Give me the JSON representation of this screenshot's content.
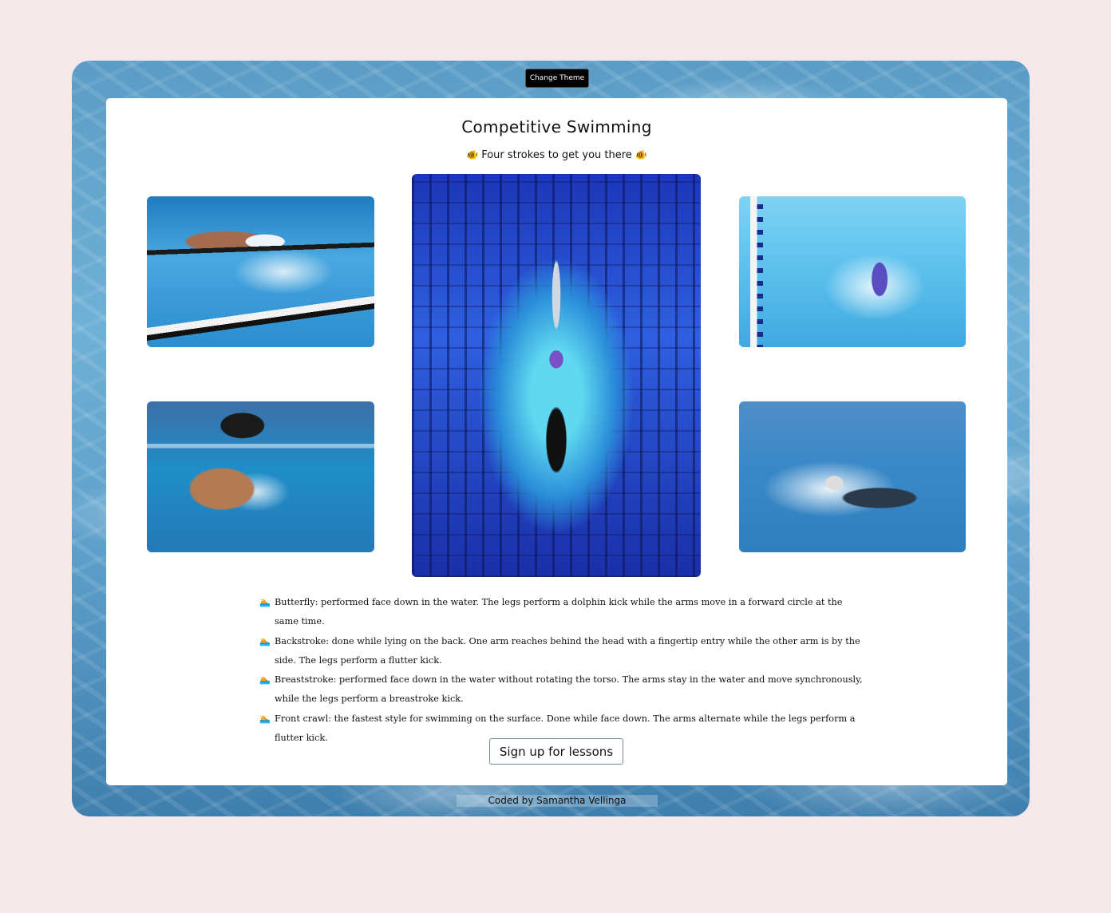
{
  "theme_button": {
    "label": "Change Theme"
  },
  "card": {
    "title": "Competitive Swimming",
    "subtitle": "Four strokes to get you there",
    "fish_icon": "🐠",
    "swimmer_icon": "🏊",
    "strokes": [
      {
        "text": "Butterfly: performed face down in the water. The legs perform a dolphin kick while the arms move in a forward circle at the same time."
      },
      {
        "text": "Backstroke: done while lying on the back. One arm reaches behind the head with a fingertip entry while the other arm is by the side. The legs perform a flutter kick."
      },
      {
        "text": "Breaststroke: performed face down in the water without rotating the torso. The arms stay in the water and move synchronously, while the legs perform a breastroke kick."
      },
      {
        "text": "Front crawl: the fastest style for swimming on the surface. Done while face down. The arms alternate while the legs perform a flutter kick."
      }
    ],
    "signup_button": {
      "label": "Sign up for lessons"
    }
  },
  "footer": {
    "text": "Coded by Samantha Vellinga"
  },
  "colors": {
    "page_background": "#f5e8eb",
    "water": "#5b9cc6",
    "card": "#ffffff",
    "button_dark": "#000000"
  }
}
